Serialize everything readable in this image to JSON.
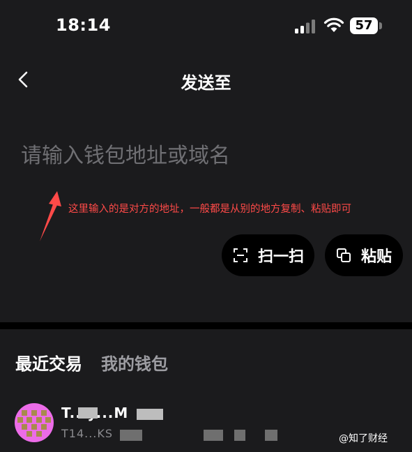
{
  "status_bar": {
    "time": "18:14",
    "battery": "57",
    "icons": [
      "cellular-signal-icon",
      "wifi-icon",
      "battery-icon"
    ]
  },
  "nav": {
    "title": "发送至",
    "back_icon": "chevron-left-icon"
  },
  "address": {
    "placeholder": "请输入钱包地址或域名",
    "value": ""
  },
  "annotation": {
    "text": "这里输入的是对方的地址，一般都是从别的地方复制、粘贴即可",
    "color": "#ff4a48"
  },
  "actions": {
    "scan_label": "扫一扫",
    "paste_label": "粘贴"
  },
  "tabs": [
    {
      "label": "最近交易",
      "active": true
    },
    {
      "label": "我的钱包",
      "active": false
    }
  ],
  "recent": [
    {
      "name": "T...y...M",
      "address": "T14...KS"
    }
  ],
  "watermark": "@知了财经",
  "colors": {
    "background": "#1b1b1d",
    "button_bg": "#000000",
    "placeholder": "#6f6f73",
    "inactive_tab": "#9d9da2",
    "annotation": "#ff4a48"
  }
}
